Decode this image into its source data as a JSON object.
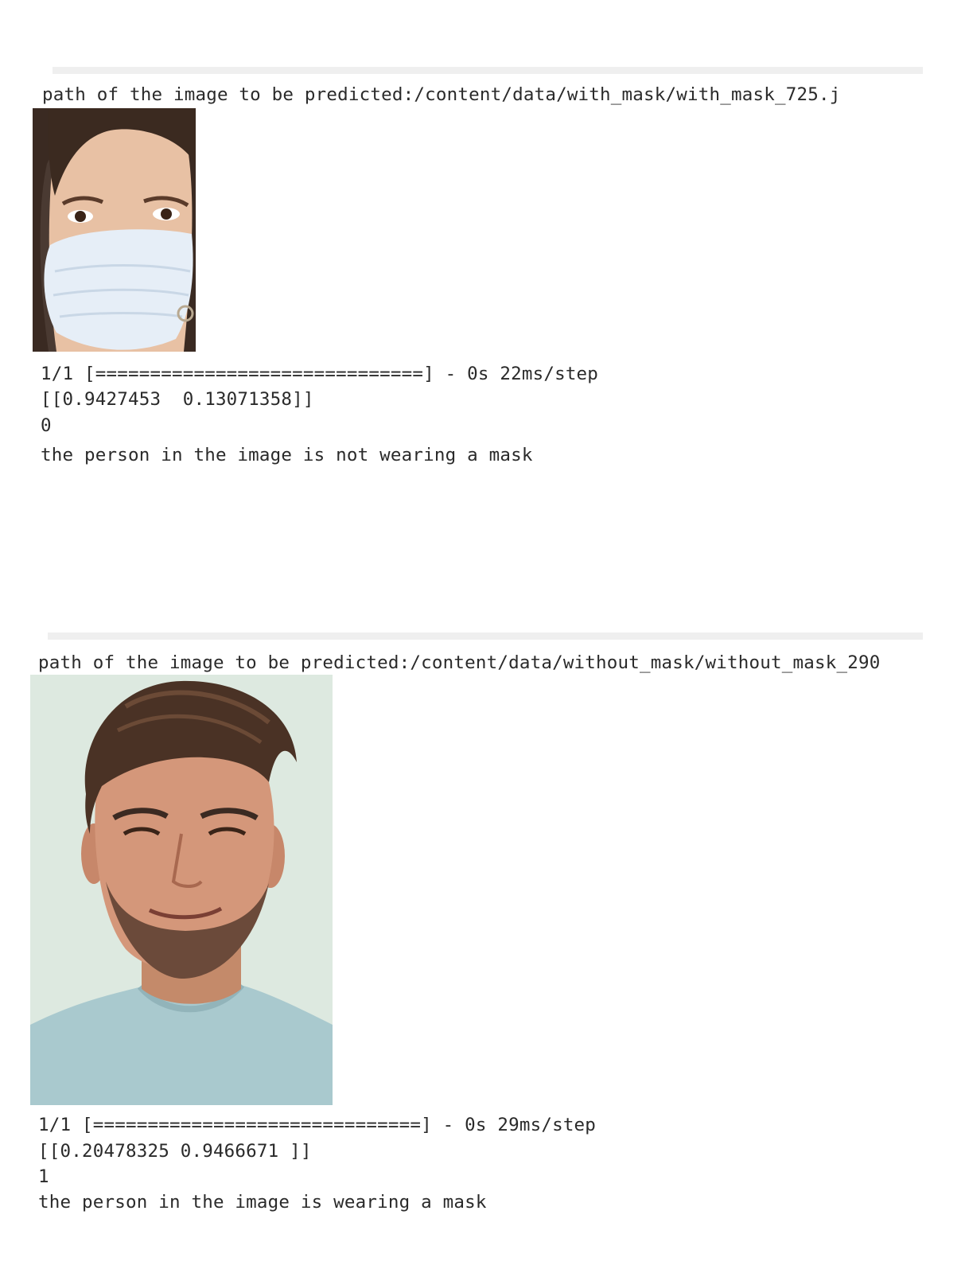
{
  "outputs": [
    {
      "path_line": "path of the image to be predicted:/content/data/with_mask/with_mask_725.j",
      "image": {
        "subject": "woman-wearing-face-mask"
      },
      "progress_line": "1/1 [==============================] - 0s 22ms/step",
      "prediction_array": "[[0.9427453  0.13071358]]",
      "predicted_label": "0",
      "result_text": "the person in the image is not wearing a mask"
    },
    {
      "path_line": "path of the image to be predicted:/content/data/without_mask/without_mask_290",
      "image": {
        "subject": "man-without-mask"
      },
      "progress_line": "1/1 [==============================] - 0s 29ms/step",
      "prediction_array": "[[0.20478325 0.9466671 ]]",
      "predicted_label": "1",
      "result_text": "the person in the image is wearing a mask"
    }
  ]
}
